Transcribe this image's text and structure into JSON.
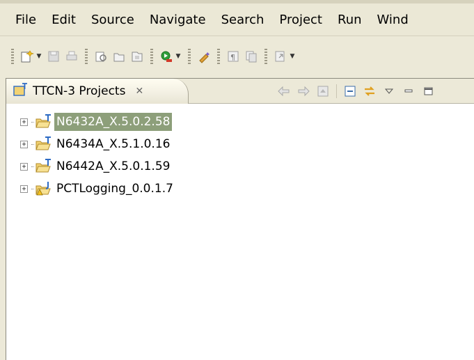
{
  "menubar": {
    "items": [
      "File",
      "Edit",
      "Source",
      "Navigate",
      "Search",
      "Project",
      "Run",
      "Wind"
    ]
  },
  "toolbar": {
    "buttons": [
      "new-wizard-icon",
      "save-icon",
      "print-icon",
      "open-type-icon",
      "open-resource-icon",
      "open-module-icon",
      "run-icon",
      "marker-icon",
      "show-whitespace-icon",
      "block-select-icon",
      "navigate-icon"
    ]
  },
  "view": {
    "tab_title": "TTCN-3 Projects",
    "tab_close": "✕",
    "actions": [
      "back-icon",
      "forward-icon",
      "home-icon",
      "collapse-all-icon",
      "link-editor-icon",
      "view-menu-icon",
      "minimize-icon",
      "maximize-icon"
    ]
  },
  "tree": {
    "items": [
      {
        "label": "N6432A_X.5.0.2.58",
        "type": "ttcn3-project",
        "selected": true,
        "expanded": false
      },
      {
        "label": "N6434A_X.5.1.0.16",
        "type": "ttcn3-project",
        "selected": false,
        "expanded": false
      },
      {
        "label": "N6442A_X.5.0.1.59",
        "type": "ttcn3-project",
        "selected": false,
        "expanded": false
      },
      {
        "label": "PCTLogging_0.0.1.7",
        "type": "java-project-warning",
        "selected": false,
        "expanded": false
      }
    ]
  },
  "colors": {
    "selection": "#8d9f7a",
    "chrome": "#ece9d8",
    "folder": "#f2d272",
    "project_badge": "#2d6bc4"
  }
}
